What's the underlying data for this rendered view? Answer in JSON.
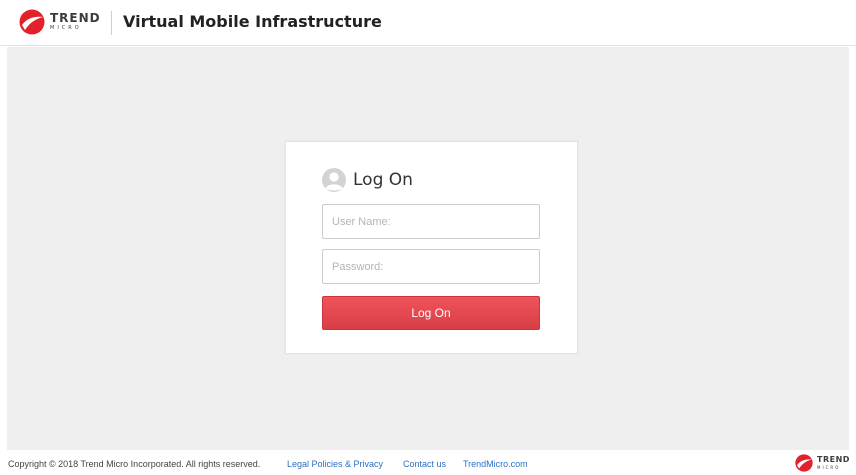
{
  "header": {
    "logo": {
      "wordmark": "TREND",
      "sub": "MICRO",
      "icon": "trend-micro-logo-icon",
      "brand_color": "#e2222b"
    },
    "app_title": "Virtual Mobile Infrastructure"
  },
  "login": {
    "title": "Log On",
    "icon": "user-avatar-icon",
    "username_placeholder": "User Name:",
    "username_value": "",
    "password_placeholder": "Password:",
    "password_value": "",
    "submit_label": "Log On",
    "accent_color": "#e0454c"
  },
  "footer": {
    "copyright": "Copyright © 2018 Trend Micro Incorporated. All rights reserved.",
    "links": [
      "Legal Policies & Privacy",
      "Contact us",
      "TrendMicro.com"
    ],
    "logo": {
      "wordmark": "TREND",
      "sub": "MICRO",
      "icon": "trend-micro-logo-icon"
    }
  }
}
